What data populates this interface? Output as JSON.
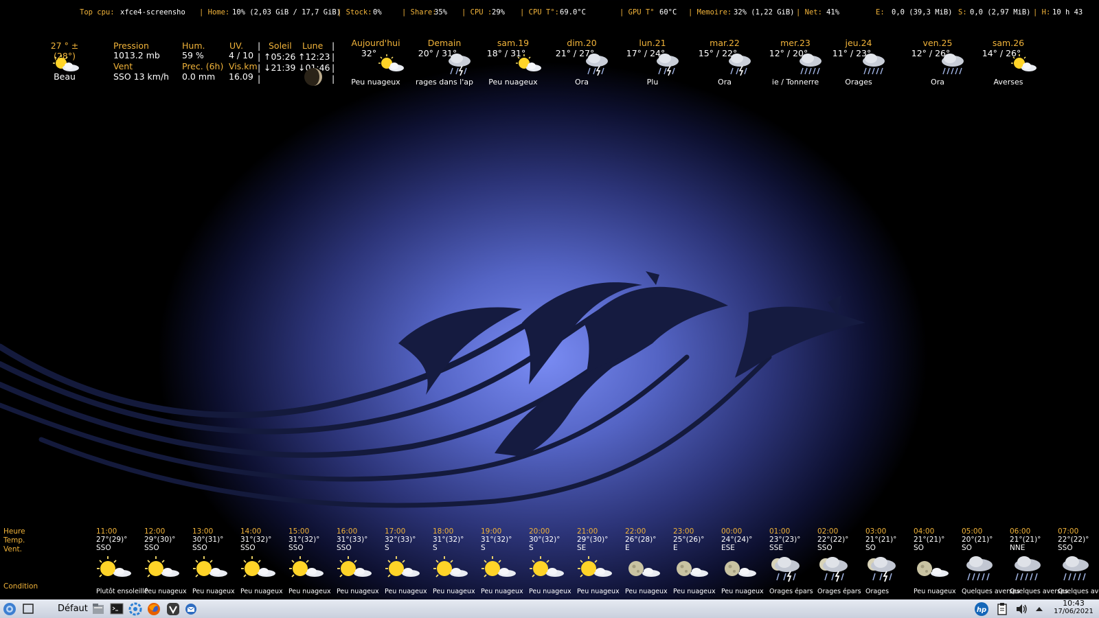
{
  "system": {
    "top_cpu_label": "Top cpu:",
    "top_cpu_value": "xfce4-screensho",
    "home_label": "| Home:",
    "home_value": "10% (2,03 GiB / 17,7 GiB)",
    "stock_label": "| Stock:",
    "stock_value": "0%",
    "share_label": "| Share:",
    "share_value": "35%",
    "cpu_label": "| CPU :",
    "cpu_value": "29%",
    "cpu_temp_label": "| CPU T°:",
    "cpu_temp_value": "69.0°C",
    "gpu_label": "| GPU T°",
    "gpu_value": "60°C",
    "mem_label": "| Memoire:",
    "mem_value": "32% (1,22 GiB)",
    "net_label": "| Net:",
    "net_value": "41%",
    "e_label": "E:",
    "e_value": "0,0 (39,3 MiB)",
    "s_label": "S:",
    "s_value": "0,0 (2,97 MiB)",
    "h_label": "| H:",
    "h_value": "10 h 43"
  },
  "current": {
    "temp": "27 ° ± (28°)",
    "condition": "Beau",
    "pressure_label": "Pression",
    "pressure_value": "1013.2 mb",
    "wind_label": "Vent",
    "wind_value": "SSO 13 km/h",
    "hum_label": "Hum.",
    "hum_value": "59 %",
    "prec_label": "Prec. (6h)",
    "prec_value": "0.0 mm",
    "uv_label": "UV.",
    "uv_value": "4 / 10",
    "vis_label": "Vis.km",
    "vis_value": "16.09",
    "sun_label": "Soleil",
    "sunrise": "↑05:26",
    "sunset": "↓21:39",
    "moon_label": "Lune",
    "moonrise": "↑12:23",
    "moonset": "↓01:46",
    "sep": "|"
  },
  "forecast": [
    {
      "day": "Aujourd'hui",
      "temps": "32°",
      "cond": "Peu nuageux",
      "icon": "sun-cloud"
    },
    {
      "day": "Demain",
      "temps": "20° / 31°",
      "cond": "rages dans l'ap",
      "icon": "storm"
    },
    {
      "day": "sam.19",
      "temps": "18° / 31°",
      "cond": "Peu nuageux",
      "icon": "sun-cloud"
    },
    {
      "day": "dim.20",
      "temps": "21° / 27°",
      "cond": "Ora",
      "icon": "storm"
    },
    {
      "day": "lun.21",
      "temps": "17° / 24°",
      "cond": "Plu",
      "icon": "storm"
    },
    {
      "day": "mar.22",
      "temps": "15° / 22°",
      "cond": "Ora",
      "icon": "storm"
    },
    {
      "day": "mer.23",
      "temps": "12° / 20°",
      "cond": "ie / Tonnerre",
      "icon": "rain"
    },
    {
      "day": "jeu.24",
      "temps": "11° / 23°",
      "cond": "Orages",
      "icon": "rain"
    },
    {
      "day": "ven.25",
      "temps": "12° / 26°",
      "cond": "Ora",
      "icon": "rain"
    },
    {
      "day": "sam.26",
      "temps": "14° / 26°",
      "cond": "Averses",
      "icon": "sun-cloud"
    }
  ],
  "hourly_labels": {
    "heure": "Heure",
    "temp": "Temp.",
    "vent": "Vent.",
    "condition": "Condition"
  },
  "hourly": [
    {
      "time": "11:00",
      "temp": "27°(29)°",
      "wind": "SSO",
      "cond": "Plutôt ensoleillé",
      "icon": "sun-cloud"
    },
    {
      "time": "12:00",
      "temp": "29°(30)°",
      "wind": "SSO",
      "cond": "Peu nuageux",
      "icon": "sun-cloud"
    },
    {
      "time": "13:00",
      "temp": "30°(31)°",
      "wind": "SSO",
      "cond": "Peu nuageux",
      "icon": "sun-cloud"
    },
    {
      "time": "14:00",
      "temp": "31°(32)°",
      "wind": "SSO",
      "cond": "Peu nuageux",
      "icon": "sun-cloud"
    },
    {
      "time": "15:00",
      "temp": "31°(32)°",
      "wind": "SSO",
      "cond": "Peu nuageux",
      "icon": "sun-cloud"
    },
    {
      "time": "16:00",
      "temp": "31°(33)°",
      "wind": "SSO",
      "cond": "Peu nuageux",
      "icon": "sun-cloud"
    },
    {
      "time": "17:00",
      "temp": "32°(33)°",
      "wind": "S",
      "cond": "Peu nuageux",
      "icon": "sun-cloud"
    },
    {
      "time": "18:00",
      "temp": "31°(32)°",
      "wind": "S",
      "cond": "Peu nuageux",
      "icon": "sun-cloud"
    },
    {
      "time": "19:00",
      "temp": "31°(32)°",
      "wind": "S",
      "cond": "Peu nuageux",
      "icon": "sun-cloud"
    },
    {
      "time": "20:00",
      "temp": "30°(32)°",
      "wind": "S",
      "cond": "Peu nuageux",
      "icon": "sun-cloud"
    },
    {
      "time": "21:00",
      "temp": "29°(30)°",
      "wind": "SE",
      "cond": "Peu nuageux",
      "icon": "sun-cloud"
    },
    {
      "time": "22:00",
      "temp": "26°(28)°",
      "wind": "E",
      "cond": "Peu nuageux",
      "icon": "moon-cloud"
    },
    {
      "time": "23:00",
      "temp": "25°(26)°",
      "wind": "E",
      "cond": "Peu nuageux",
      "icon": "moon-cloud"
    },
    {
      "time": "00:00",
      "temp": "24°(24)°",
      "wind": "ESE",
      "cond": "Peu nuageux",
      "icon": "moon-cloud"
    },
    {
      "time": "01:00",
      "temp": "23°(23)°",
      "wind": "SSE",
      "cond": "Orages épars",
      "icon": "storm"
    },
    {
      "time": "02:00",
      "temp": "22°(22)°",
      "wind": "SSO",
      "cond": "Orages épars",
      "icon": "storm"
    },
    {
      "time": "03:00",
      "temp": "21°(21)°",
      "wind": "SO",
      "cond": "Orages",
      "icon": "storm"
    },
    {
      "time": "04:00",
      "temp": "21°(21)°",
      "wind": "SO",
      "cond": "Peu nuageux",
      "icon": "moon-cloud"
    },
    {
      "time": "05:00",
      "temp": "20°(21)°",
      "wind": "SO",
      "cond": "Quelques averses",
      "icon": "rain"
    },
    {
      "time": "06:00",
      "temp": "21°(21)°",
      "wind": "NNE",
      "cond": "Quelques averses",
      "icon": "rain"
    },
    {
      "time": "07:00",
      "temp": "22°(22)°",
      "wind": "SSO",
      "cond": "Quelques averses",
      "icon": "rain"
    }
  ],
  "taskbar": {
    "workspace_label": "Défaut",
    "time": "10:43",
    "date": "17/06/2021"
  }
}
